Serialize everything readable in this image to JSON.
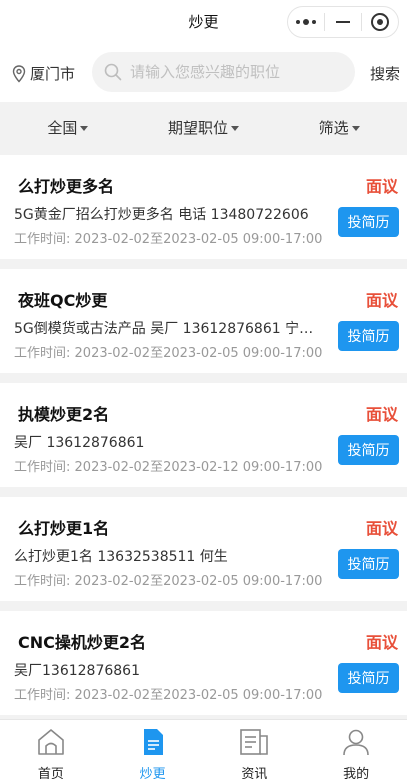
{
  "header": {
    "title": "炒更"
  },
  "search": {
    "city": "厦门市",
    "placeholder": "请输入您感兴趣的职位",
    "button": "搜索"
  },
  "filters": [
    {
      "label": "全国"
    },
    {
      "label": "期望职位"
    },
    {
      "label": "筛选"
    }
  ],
  "jobs": [
    {
      "title": "么打炒更多名",
      "salary": "面议",
      "desc": "5G黄金厂招么打炒更多名 电话 13480722606",
      "time_label": "工作时间:",
      "time": "2023-02-02至2023-02-05 09:00-17:00",
      "apply": "投简历"
    },
    {
      "title": "夜班QC炒更",
      "salary": "面议",
      "desc": "5G倒模货或古法产品 吴厂 13612876861 宁…",
      "time_label": "工作时间:",
      "time": "2023-02-02至2023-02-05 09:00-17:00",
      "apply": "投简历"
    },
    {
      "title": "执模炒更2名",
      "salary": "面议",
      "desc": "吴厂 13612876861",
      "time_label": "工作时间:",
      "time": "2023-02-02至2023-02-12 09:00-17:00",
      "apply": "投简历"
    },
    {
      "title": "么打炒更1名",
      "salary": "面议",
      "desc": "么打炒更1名 13632538511 何生",
      "time_label": "工作时间:",
      "time": "2023-02-02至2023-02-05 09:00-17:00",
      "apply": "投简历"
    },
    {
      "title": "CNC操机炒更2名",
      "salary": "面议",
      "desc": "吴厂13612876861",
      "time_label": "工作时间:",
      "time": "2023-02-02至2023-02-05 09:00-17:00",
      "apply": "投简历"
    }
  ],
  "tabbar": [
    {
      "label": "首页",
      "icon": "home-icon"
    },
    {
      "label": "炒更",
      "icon": "document-icon",
      "active": true
    },
    {
      "label": "资讯",
      "icon": "news-icon"
    },
    {
      "label": "我的",
      "icon": "person-icon"
    }
  ],
  "colors": {
    "accent": "#1e96ef",
    "salary": "#e8503a"
  }
}
